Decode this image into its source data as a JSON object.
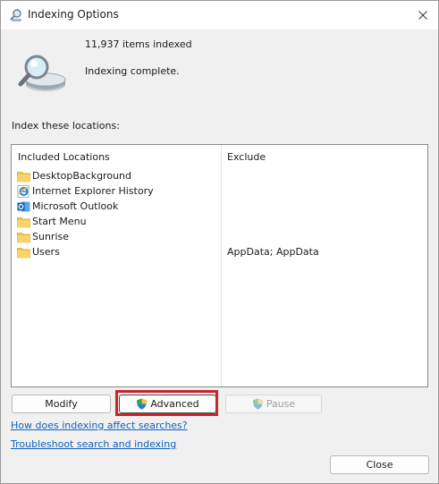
{
  "window": {
    "title": "Indexing Options"
  },
  "summary": {
    "items_indexed": "11,937 items indexed",
    "status": "Indexing complete."
  },
  "locations": {
    "section_label": "Index these locations:",
    "columns": {
      "included": "Included Locations",
      "exclude": "Exclude"
    },
    "rows": [
      {
        "name": "DesktopBackground",
        "exclude": "",
        "icon": "folder-icon"
      },
      {
        "name": "Internet Explorer History",
        "exclude": "",
        "icon": "internet-explorer-icon"
      },
      {
        "name": "Microsoft Outlook",
        "exclude": "",
        "icon": "outlook-icon"
      },
      {
        "name": "Start Menu",
        "exclude": "",
        "icon": "folder-icon"
      },
      {
        "name": "Sunrise",
        "exclude": "",
        "icon": "folder-icon"
      },
      {
        "name": "Users",
        "exclude": "AppData; AppData",
        "icon": "folder-icon"
      }
    ]
  },
  "buttons": {
    "modify": "Modify",
    "advanced": "Advanced",
    "pause": "Pause",
    "close": "Close"
  },
  "links": {
    "how": "How does indexing affect searches?",
    "troubleshoot": "Troubleshoot search and indexing"
  },
  "colors": {
    "link": "#0f5fbd",
    "highlight": "#c8252c",
    "folder": "#f4c54a"
  }
}
